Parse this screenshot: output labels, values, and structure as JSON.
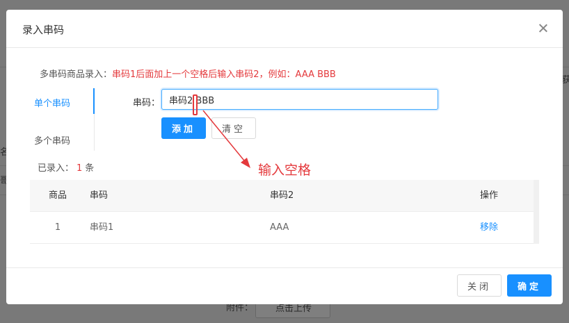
{
  "dialog": {
    "title": "录入串码",
    "tip_label": "多串码商品录入：",
    "tip_text": "串码1后面加上一个空格后输入串码2，例如：AAA BBB",
    "tabs": [
      {
        "label": "单个串码",
        "active": true
      },
      {
        "label": "多个串码",
        "active": false
      }
    ],
    "serial_label": "串码：",
    "serial_value": "串码2 BBB",
    "add_label": "添加",
    "clear_label": "清空",
    "recorded_prefix": "已录入：",
    "recorded_count": "1",
    "recorded_unit": "条",
    "annotation": "输入空格",
    "table": {
      "headers": {
        "goods": "商品",
        "sn": "串码",
        "sn2": "串码2",
        "op": "操作"
      },
      "rows": [
        {
          "goods": "1",
          "sn": "串码1",
          "sn2": "AAA",
          "op": "移除"
        }
      ]
    },
    "footer": {
      "close_label": "关闭",
      "ok_label": "确定"
    }
  },
  "background": {
    "attachment_label": "附件：",
    "upload_label": "点击上传",
    "edge_chars": [
      "名",
      "哥",
      "获"
    ]
  },
  "colors": {
    "accent": "#1890ff",
    "danger": "#e4393c",
    "overlay": "rgba(0,0,0,0.5)"
  }
}
